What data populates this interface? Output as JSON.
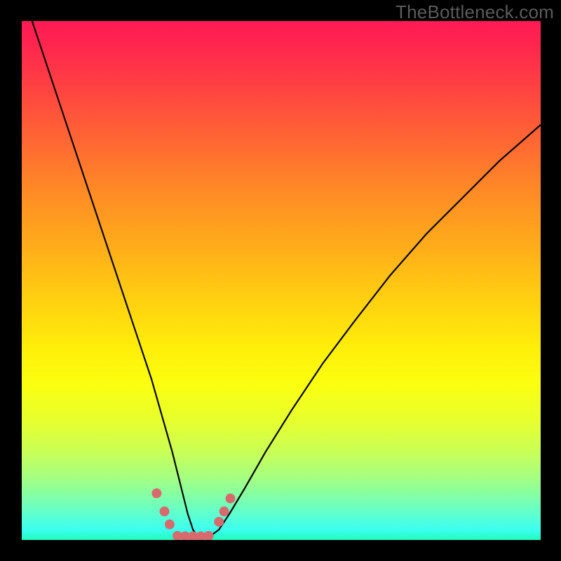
{
  "watermark": "TheBottleneck.com",
  "colors": {
    "frame": "#000000",
    "curve": "#050505",
    "marker": "#d86a6d",
    "gradient_top": "#ff1a54",
    "gradient_bottom": "#22fbbd"
  },
  "chart_data": {
    "type": "line",
    "title": "",
    "xlabel": "",
    "ylabel": "",
    "xlim": [
      0,
      100
    ],
    "ylim": [
      0,
      100
    ],
    "x": [
      0,
      2,
      5,
      8,
      11,
      14,
      17,
      20,
      23,
      25,
      27,
      29,
      30,
      31,
      32,
      33,
      34,
      36,
      38,
      40,
      43,
      47,
      52,
      58,
      64,
      71,
      78,
      85,
      92,
      100
    ],
    "y": [
      106,
      100,
      91,
      82,
      73,
      64,
      55,
      46,
      37,
      31,
      24,
      17,
      13,
      9,
      5,
      2,
      0.5,
      0.5,
      2,
      5,
      10,
      17,
      25,
      34,
      42,
      51,
      59,
      66,
      73,
      80
    ],
    "series": [
      {
        "name": "bottleneck-curve",
        "type": "line",
        "color": "#050505"
      }
    ],
    "markers": {
      "color": "#d86a6d",
      "radius_pct": 0.95,
      "points": [
        {
          "x": 26.0,
          "y": 9.0
        },
        {
          "x": 27.5,
          "y": 5.5
        },
        {
          "x": 28.5,
          "y": 3.0
        },
        {
          "x": 30.0,
          "y": 0.8
        },
        {
          "x": 31.5,
          "y": 0.7
        },
        {
          "x": 33.0,
          "y": 0.7
        },
        {
          "x": 34.5,
          "y": 0.7
        },
        {
          "x": 36.0,
          "y": 0.8
        },
        {
          "x": 38.0,
          "y": 3.5
        },
        {
          "x": 39.0,
          "y": 5.5
        },
        {
          "x": 40.2,
          "y": 8.0
        }
      ]
    },
    "background": {
      "type": "vertical-gradient",
      "stops": [
        {
          "pct": 0,
          "color": "#ff1a54"
        },
        {
          "pct": 24,
          "color": "#ff6a32"
        },
        {
          "pct": 54,
          "color": "#ffd110"
        },
        {
          "pct": 77,
          "color": "#c9ff56"
        },
        {
          "pct": 100,
          "color": "#22fbbd"
        }
      ]
    }
  }
}
